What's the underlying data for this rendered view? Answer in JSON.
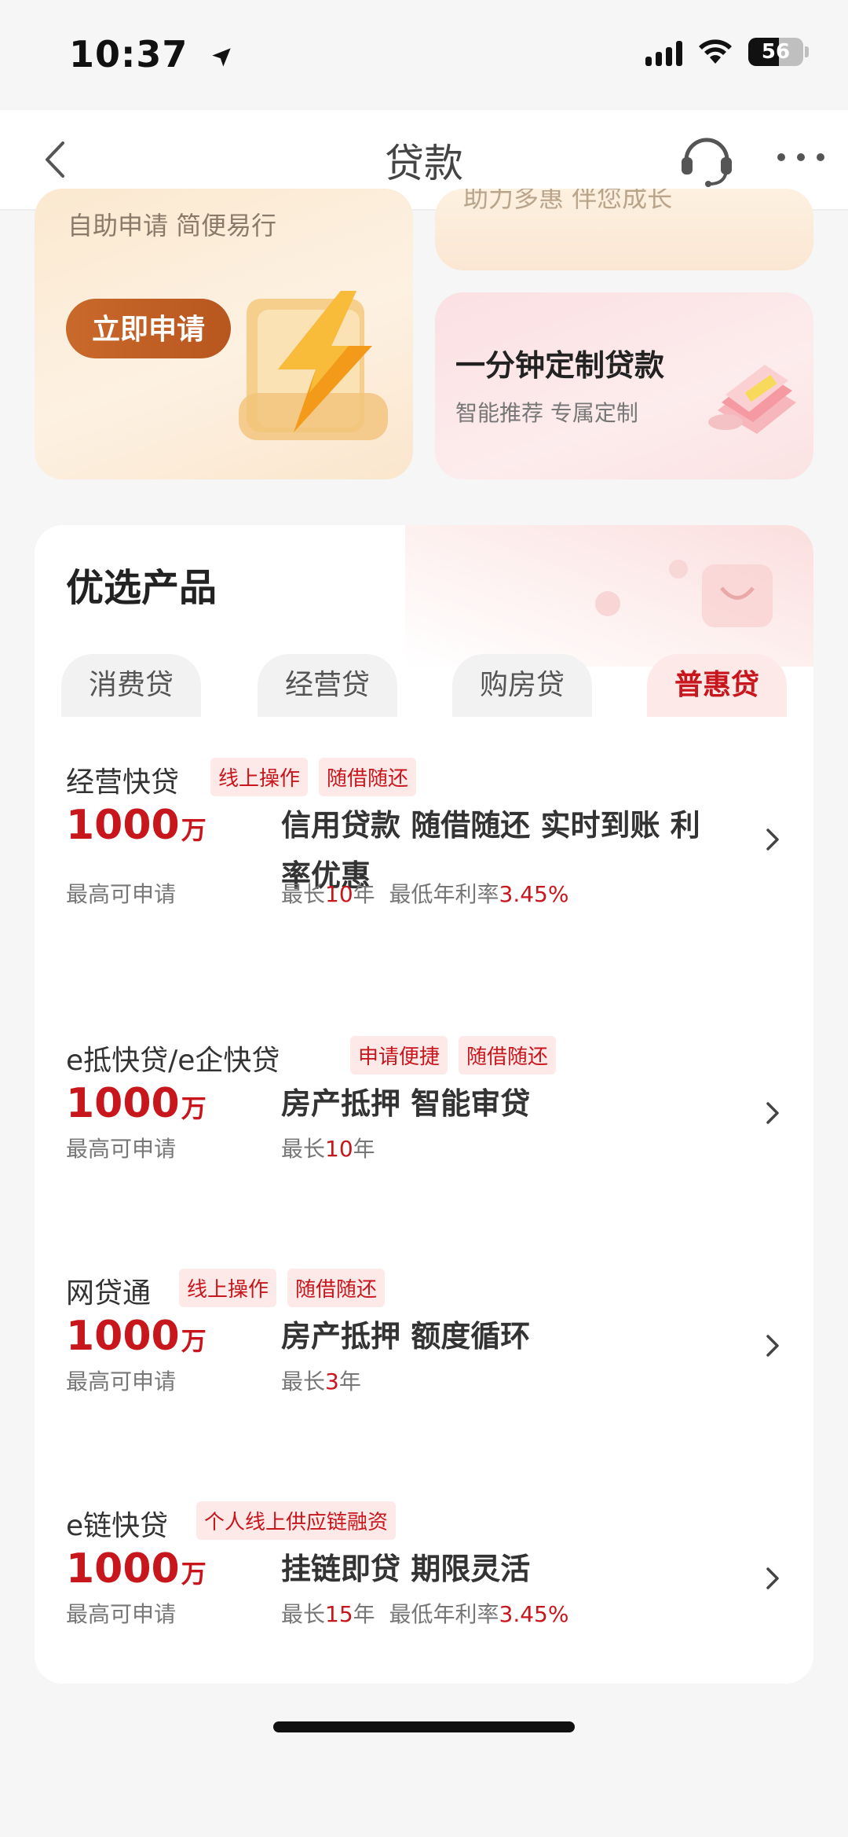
{
  "status": {
    "time": "10:37",
    "battery": "56"
  },
  "nav": {
    "title": "贷款"
  },
  "banners": {
    "left": {
      "subtitle": "自助申请 简便易行",
      "button": "立即申请"
    },
    "right_top": {
      "clipped_text": "助力多惠 伴您成长"
    },
    "right_bottom": {
      "title": "一分钟定制贷款",
      "subtitle": "智能推荐 专属定制"
    }
  },
  "card": {
    "title": "优选产品",
    "tabs": [
      {
        "label": "消费贷"
      },
      {
        "label": "经营贷"
      },
      {
        "label": "购房贷"
      },
      {
        "label": "普惠贷"
      }
    ],
    "products": [
      {
        "name": "经营快贷",
        "tags": [
          "线上操作",
          "随借随还"
        ],
        "amount": "1000",
        "unit": "万",
        "max_label": "最高可申请",
        "desc": "信用贷款 随借随还 实时到账 利率优惠",
        "term_label": "最长",
        "term_value": "10",
        "term_unit": "年",
        "rate_label": "最低年利率",
        "rate_value": "3.45%"
      },
      {
        "name": "e抵快贷/e企快贷",
        "tags": [
          "申请便捷",
          "随借随还"
        ],
        "amount": "1000",
        "unit": "万",
        "max_label": "最高可申请",
        "desc": "房产抵押 智能审贷",
        "term_label": "最长",
        "term_value": "10",
        "term_unit": "年"
      },
      {
        "name": "网贷通",
        "tags": [
          "线上操作",
          "随借随还"
        ],
        "amount": "1000",
        "unit": "万",
        "max_label": "最高可申请",
        "desc": "房产抵押 额度循环",
        "term_label": "最长",
        "term_value": "3",
        "term_unit": "年"
      },
      {
        "name": "e链快贷",
        "tags": [
          "个人线上供应链融资"
        ],
        "amount": "1000",
        "unit": "万",
        "max_label": "最高可申请",
        "desc": "挂链即贷 期限灵活",
        "term_label": "最长",
        "term_value": "15",
        "term_unit": "年",
        "rate_label": "最低年利率",
        "rate_value": "3.45%"
      }
    ]
  },
  "colors": {
    "accent": "#c8161d",
    "tag_bg": "#fde9e8",
    "apply_btn": "#c0602a"
  }
}
